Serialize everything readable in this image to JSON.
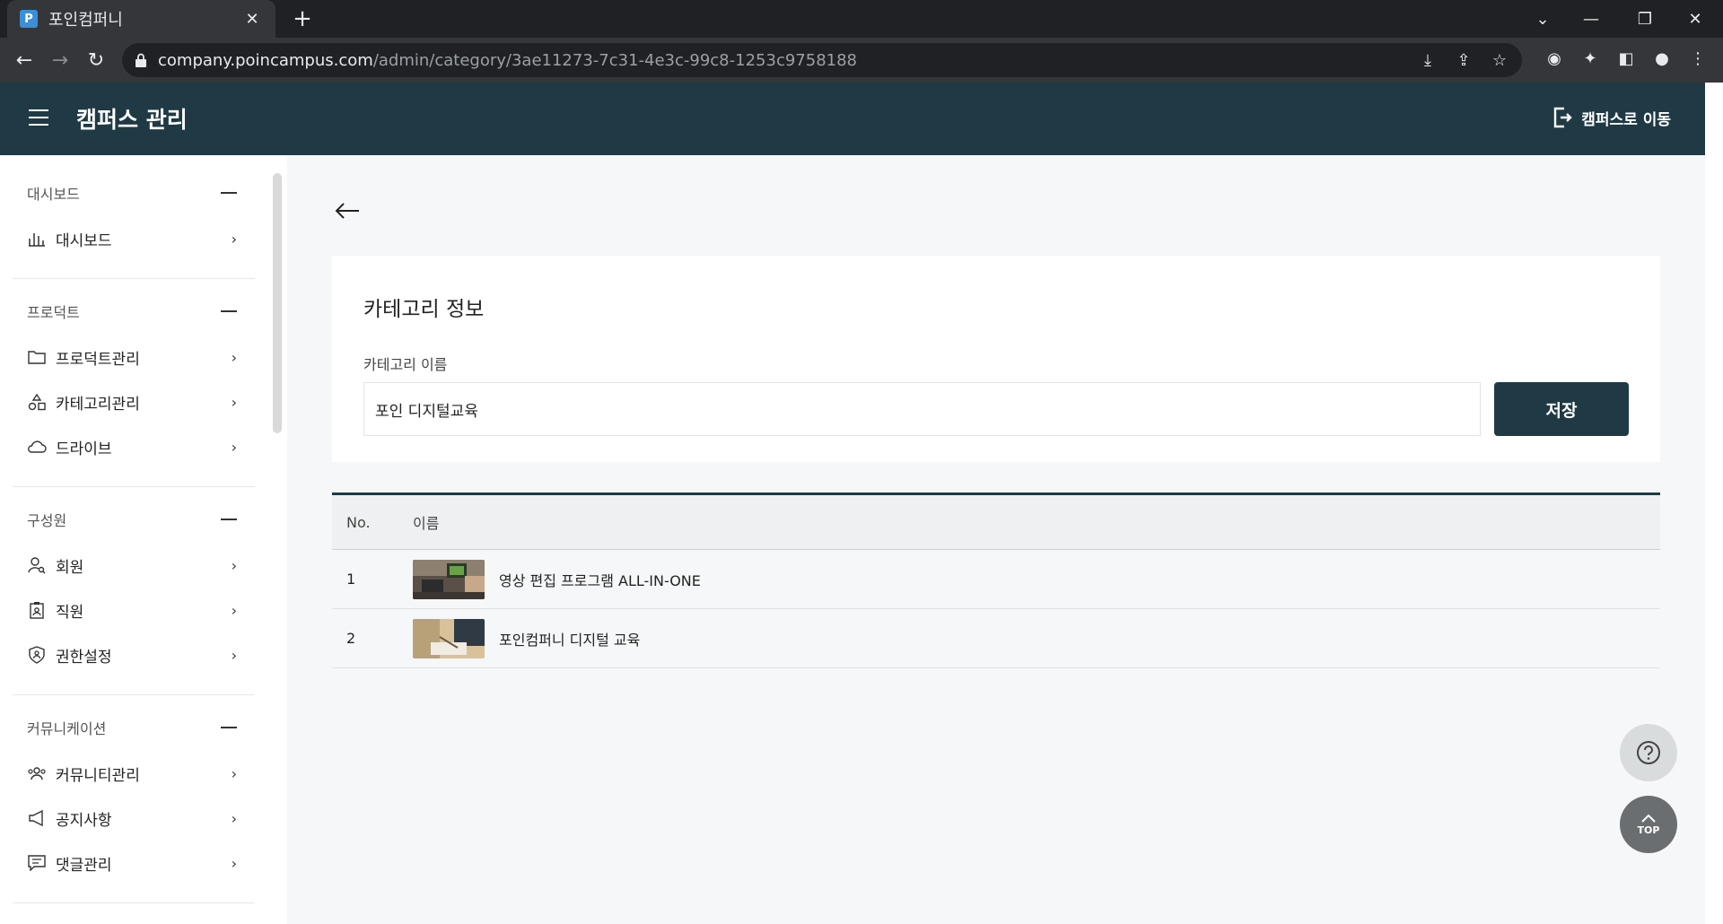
{
  "browser": {
    "tab_title": "포인컴퍼니",
    "favicon_letter": "P",
    "url_host": "company.poincampus.com",
    "url_path": "/admin/category/3ae11273-7c31-4e3c-99c8-1253c9758188"
  },
  "header": {
    "title": "캠퍼스 관리",
    "goto_label": "캠퍼스로 이동"
  },
  "sidebar": {
    "sections": [
      {
        "heading": "대시보드",
        "items": [
          {
            "label": "대시보드",
            "icon": "bar-chart-icon"
          }
        ]
      },
      {
        "heading": "프로덕트",
        "items": [
          {
            "label": "프로덕트관리",
            "icon": "folder-icon"
          },
          {
            "label": "카테고리관리",
            "icon": "shapes-icon"
          },
          {
            "label": "드라이브",
            "icon": "cloud-icon"
          }
        ]
      },
      {
        "heading": "구성원",
        "items": [
          {
            "label": "회원",
            "icon": "user-search-icon"
          },
          {
            "label": "직원",
            "icon": "badge-icon"
          },
          {
            "label": "권한설정",
            "icon": "shield-icon"
          }
        ]
      },
      {
        "heading": "커뮤니케이션",
        "items": [
          {
            "label": "커뮤니티관리",
            "icon": "group-icon"
          },
          {
            "label": "공지사항",
            "icon": "megaphone-icon"
          },
          {
            "label": "댓글관리",
            "icon": "comment-icon"
          }
        ]
      }
    ]
  },
  "main": {
    "card_title": "카테고리 정보",
    "field_label": "카테고리 이름",
    "field_value": "포인 디지털교육",
    "save_label": "저장",
    "table": {
      "col_no": "No.",
      "col_name": "이름",
      "rows": [
        {
          "no": "1",
          "name": "영상 편집 프로그램 ALL-IN-ONE"
        },
        {
          "no": "2",
          "name": "포인컴퍼니 디지털 교육"
        }
      ]
    }
  },
  "fab": {
    "top_label": "TOP"
  },
  "colors": {
    "brand": "#1f3a44",
    "background": "#f6f7f8"
  }
}
